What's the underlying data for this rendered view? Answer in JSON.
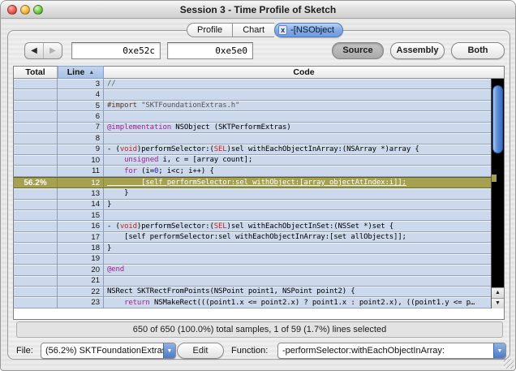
{
  "colors": {
    "plain": "#000000",
    "keyword": "#a3218e",
    "type": "#c5261c",
    "number": "#2720d9",
    "comment": "#3e7a3e",
    "string": "#575757",
    "preproc": "#5a3a20",
    "highlight_row": "#a5a151",
    "row_background": "#ccd8ec",
    "active_tab": "#6f9cdf",
    "scroll_thumb": "#5b8ed8"
  },
  "window": {
    "title": "Session 3 - Time Profile of Sketch"
  },
  "icons": {
    "close": "x",
    "back": "◀",
    "forward": "▶",
    "sort_asc": "▲",
    "scroll_up": "▲",
    "scroll_down": "▼",
    "popup_arrow": "▼"
  },
  "tabs": [
    {
      "label": "Profile",
      "active": false
    },
    {
      "label": "Chart",
      "active": false
    },
    {
      "label": "-[NSObject",
      "active": true,
      "closable": true
    }
  ],
  "toolbar": {
    "address_from": "0xe52c",
    "address_to": "0xe5e0",
    "view_buttons": [
      {
        "label": "Source",
        "selected": true
      },
      {
        "label": "Assembly",
        "selected": false
      },
      {
        "label": "Both",
        "selected": false
      }
    ]
  },
  "table": {
    "columns": {
      "total": "Total",
      "line": "Line",
      "code": "Code"
    },
    "sort_column": "Line",
    "rows": [
      {
        "line": "3",
        "total": "",
        "code": [
          {
            "t": "//",
            "c": "comment"
          }
        ]
      },
      {
        "line": "4",
        "total": "",
        "code": []
      },
      {
        "line": "5",
        "total": "",
        "code": [
          {
            "t": "#import ",
            "c": "preproc"
          },
          {
            "t": "\"SKTFoundationExtras.h\"",
            "c": "string"
          }
        ]
      },
      {
        "line": "6",
        "total": "",
        "code": []
      },
      {
        "line": "7",
        "total": "",
        "code": [
          {
            "t": "@implementation",
            "c": "keyword"
          },
          {
            "t": " NSObject (SKTPerformExtras)"
          }
        ]
      },
      {
        "line": "8",
        "total": "",
        "code": []
      },
      {
        "line": "9",
        "total": "",
        "code": [
          {
            "t": "- ("
          },
          {
            "t": "void",
            "c": "type"
          },
          {
            "t": ")performSelector:("
          },
          {
            "t": "SEL",
            "c": "type"
          },
          {
            "t": ")sel withEachObjectInArray:(NSArray *)array {"
          }
        ]
      },
      {
        "line": "10",
        "total": "",
        "code": [
          {
            "t": "    "
          },
          {
            "t": "unsigned",
            "c": "keyword"
          },
          {
            "t": " i, c = [array count];"
          }
        ]
      },
      {
        "line": "11",
        "total": "",
        "code": [
          {
            "t": "    "
          },
          {
            "t": "for",
            "c": "keyword"
          },
          {
            "t": " (i="
          },
          {
            "t": "0",
            "c": "number"
          },
          {
            "t": "; i<c; i++) {"
          }
        ]
      },
      {
        "line": "12",
        "total": "56.2%",
        "highlight": true,
        "code": [
          {
            "t": "        [self performSelector:sel withObject:[array objectAtIndex:i]];"
          }
        ]
      },
      {
        "line": "13",
        "total": "",
        "code": [
          {
            "t": "    }"
          }
        ]
      },
      {
        "line": "14",
        "total": "",
        "code": [
          {
            "t": "}"
          }
        ]
      },
      {
        "line": "15",
        "total": "",
        "code": []
      },
      {
        "line": "16",
        "total": "",
        "code": [
          {
            "t": "- ("
          },
          {
            "t": "void",
            "c": "type"
          },
          {
            "t": ")performSelector:("
          },
          {
            "t": "SEL",
            "c": "type"
          },
          {
            "t": ")sel withEachObjectInSet:(NSSet *)set {"
          }
        ]
      },
      {
        "line": "17",
        "total": "",
        "code": [
          {
            "t": "    [self performSelector:sel withEachObjectInArray:[set allObjects]];"
          }
        ]
      },
      {
        "line": "18",
        "total": "",
        "code": [
          {
            "t": "}"
          }
        ]
      },
      {
        "line": "19",
        "total": "",
        "code": []
      },
      {
        "line": "20",
        "total": "",
        "code": [
          {
            "t": "@end",
            "c": "keyword"
          }
        ]
      },
      {
        "line": "21",
        "total": "",
        "code": []
      },
      {
        "line": "22",
        "total": "",
        "code": [
          {
            "t": "NSRect SKTRectFromPoints(NSPoint point1, NSPoint point2) {"
          }
        ]
      },
      {
        "line": "23",
        "total": "",
        "code": [
          {
            "t": "    "
          },
          {
            "t": "return",
            "c": "keyword"
          },
          {
            "t": " NSMakeRect(((point1.x <= point2.x) ? point1.x : point2.x), ((point1.y <= p…"
          }
        ]
      }
    ]
  },
  "status_bar": {
    "text": "650 of 650 (100.0%) total samples, 1 of 59 (1.7%) lines selected"
  },
  "footer": {
    "file_label": "File:",
    "file_value": "(56.2%) SKTFoundationExtras",
    "edit_button": "Edit",
    "function_label": "Function:",
    "function_value": "-performSelector:withEachObjectInArray:"
  }
}
